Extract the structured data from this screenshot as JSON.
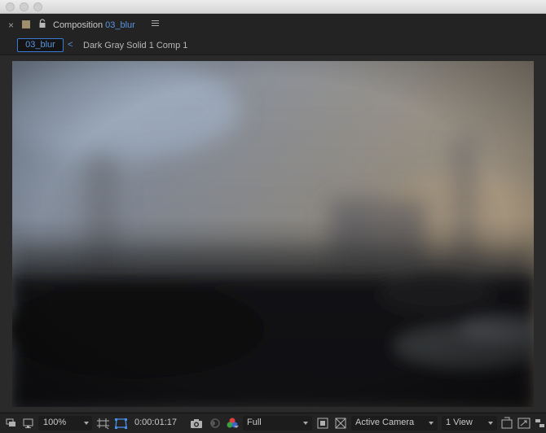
{
  "panel": {
    "close_glyph": "×",
    "title_prefix": "Composition",
    "composition_name": "03_blur"
  },
  "breadcrumbs": {
    "active": "03_blur",
    "chevron": "<",
    "next": "Dark Gray Solid 1 Comp 1"
  },
  "toolbar": {
    "magnification": "100%",
    "timecode": "0:00:01:17",
    "resolution": "Full",
    "camera": "Active Camera",
    "views": "1 View"
  },
  "colors": {
    "accent": "#3a7bd5",
    "accent_text": "#5a95e0",
    "panel_bg": "#232323",
    "label_swatch": "#9e8e6e"
  },
  "icons": {
    "always_preview": "always-preview-icon",
    "monitor": "monitor-icon",
    "grid_guides": "grid-guides-icon",
    "mask_visibility": "mask-visibility-icon",
    "snapshot": "camera-snapshot-icon",
    "show_snapshot": "show-snapshot-icon",
    "color_channels": "rgb-channels-icon",
    "region_of_interest": "region-of-interest-icon",
    "transparency_grid": "transparency-grid-icon",
    "fast_previews": "fast-previews-icon",
    "timeline": "timeline-icon",
    "flowchart": "flowchart-icon"
  }
}
